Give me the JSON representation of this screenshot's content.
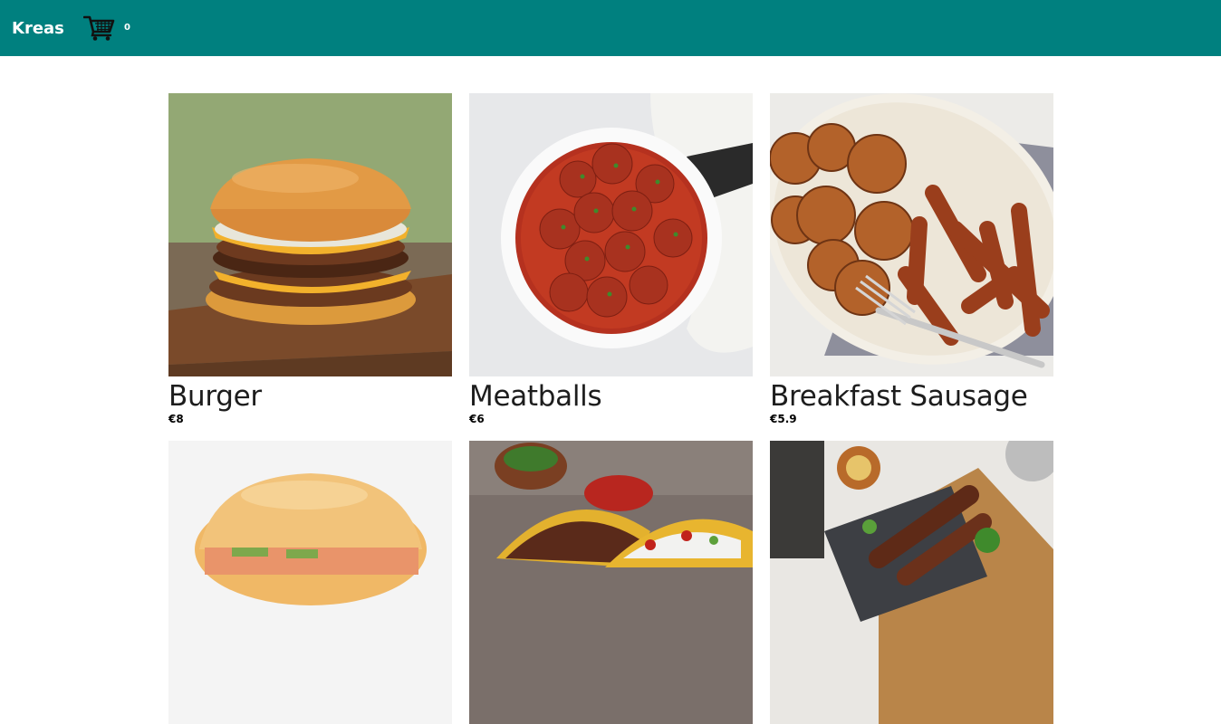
{
  "header": {
    "brand": "Kreas",
    "cart_count": "0",
    "background": "#00807f"
  },
  "products": [
    {
      "name": "Burger",
      "price": "€8",
      "image": "burger-photo"
    },
    {
      "name": "Meatballs",
      "price": "€6",
      "image": "meatballs-photo"
    },
    {
      "name": "Breakfast Sausage",
      "price": "€5.9",
      "image": "breakfast-sausage-photo"
    },
    {
      "name": "",
      "price": "",
      "image": "chicken-sandwich-photo"
    },
    {
      "name": "",
      "price": "",
      "image": "tacos-photo"
    },
    {
      "name": "",
      "price": "",
      "image": "kebab-photo"
    }
  ]
}
